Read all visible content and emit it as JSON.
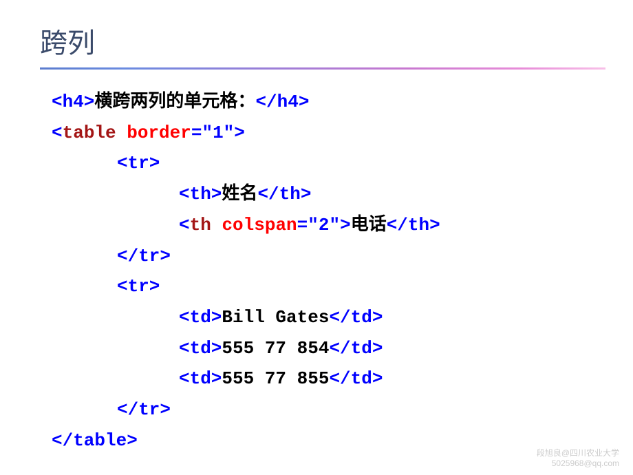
{
  "slide": {
    "title": "跨列"
  },
  "code": {
    "h4_open": "<h4>",
    "h4_text": "横跨两列的单元格：",
    "h4_close": "</h4>",
    "table_open_bracket": "<",
    "table_tag": "table",
    "table_attr_sep": " ",
    "border_attr": "border",
    "border_eq": "=",
    "border_val": "\"1\"",
    "table_close_bracket": ">",
    "tr_open": "<tr>",
    "th_open": "<th>",
    "th1_text": "姓名",
    "th_close": "</th>",
    "th2_open_bracket": "<",
    "th_tag": "th",
    "colspan_attr": "colspan",
    "colspan_eq": "=",
    "colspan_val": "\"2\"",
    "th2_close_bracket": ">",
    "th2_text": "电话",
    "tr_close": "</tr>",
    "td_open": "<td>",
    "td1_text": "Bill Gates",
    "td_close": "</td>",
    "td2_text": "555 77 854",
    "td3_text": "555 77 855",
    "table_closetag": "</table>"
  },
  "footer": {
    "line1": "段旭良@四川农业大学",
    "line2": "5025968@qq.com"
  }
}
